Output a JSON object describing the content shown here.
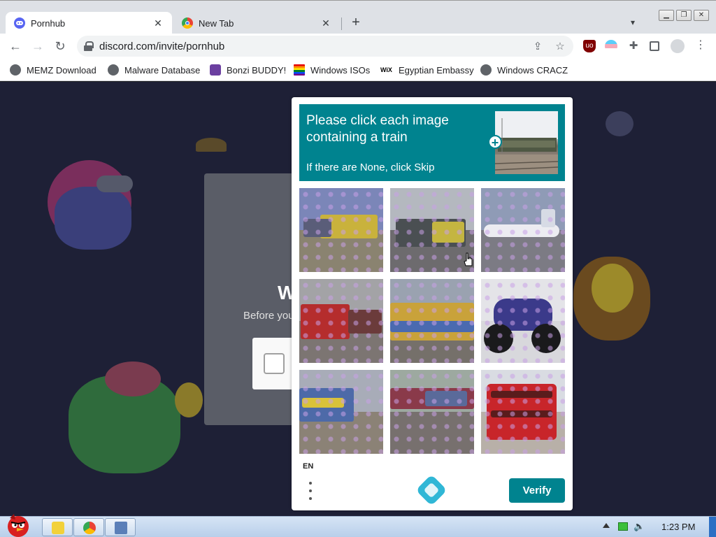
{
  "browser": {
    "tabs": [
      {
        "title": "Pornhub",
        "active": true,
        "favicon": "discord-icon"
      },
      {
        "title": "New Tab",
        "active": false,
        "favicon": "chrome-icon"
      }
    ],
    "new_tab_symbol": "+",
    "url": "discord.com/invite/pornhub",
    "bookmarks": [
      {
        "label": "MEMZ Download",
        "icon": "globe-icon"
      },
      {
        "label": "Malware Database",
        "icon": "globe-icon"
      },
      {
        "label": "Bonzi BUDDY!",
        "icon": "bonzi-icon"
      },
      {
        "label": "Windows ISOs",
        "icon": "rainbow-flag-icon"
      },
      {
        "label": "Egyptian Embassy",
        "icon": "wix-icon"
      },
      {
        "label": "Windows CRACZ",
        "icon": "globe-icon"
      }
    ],
    "wix_logo_text": "WiX"
  },
  "discord": {
    "join_heading_partial": "W",
    "join_sub_partial": "Before you"
  },
  "captcha": {
    "prompt_title": "Please click each image containing a train",
    "prompt_sub": "If there are None, click Skip",
    "tiles": [
      {
        "label": "train",
        "selected": false
      },
      {
        "label": "train",
        "selected": true
      },
      {
        "label": "airplane",
        "selected": false
      },
      {
        "label": "train",
        "selected": false
      },
      {
        "label": "train",
        "selected": false
      },
      {
        "label": "motorcycle",
        "selected": false
      },
      {
        "label": "train",
        "selected": false
      },
      {
        "label": "train",
        "selected": false
      },
      {
        "label": "bus",
        "selected": false
      }
    ],
    "language": "EN",
    "verify_label": "Verify"
  },
  "taskbar": {
    "clock": "1:23 PM"
  },
  "colors": {
    "hcaptcha_teal": "#00838f",
    "discord_bg": "#1e2036"
  }
}
